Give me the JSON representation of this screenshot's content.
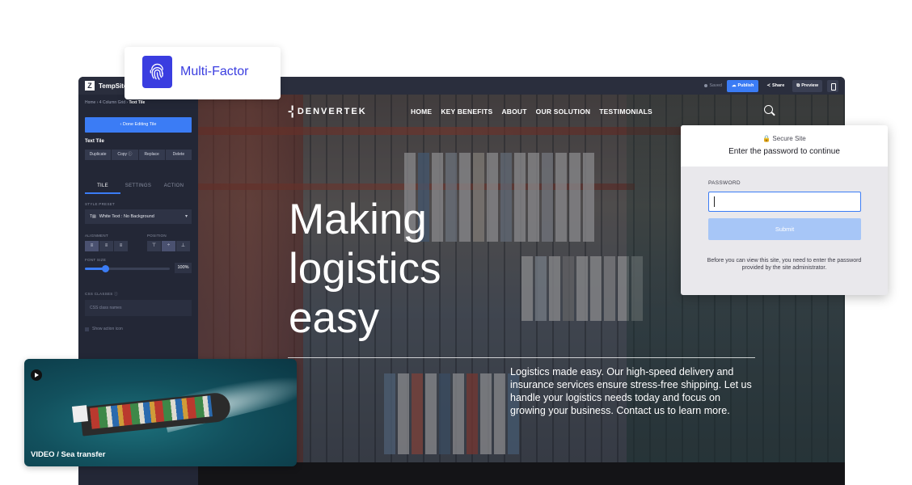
{
  "app": {
    "brand_name": "TempSite",
    "brand_logo_letter": "Z",
    "saved_label": "Saved",
    "publish_label": "Publish",
    "share_label": "Share",
    "preview_label": "Preview"
  },
  "sidebar": {
    "breadcrumb": [
      "Home",
      "4 Column Grid",
      "Text Tile"
    ],
    "done_label": "‹  Done Editing Tile",
    "tile_title": "Text Tile",
    "actions": [
      "Duplicate",
      "Copy ⓘ",
      "Replace",
      "Delete"
    ],
    "tabs": [
      "TILE",
      "SETTINGS",
      "ACTION"
    ],
    "active_tab": "TILE",
    "style_preset_label": "STYLE PRESET",
    "style_preset_value": "White Text : No Background",
    "alignment_label": "ALIGNMENT",
    "position_label": "POSITION",
    "font_size_label": "FONT SIZE",
    "font_size_value": "100%",
    "font_size_fraction": 0.24,
    "css_classes_label": "CSS CLASSES ⓘ",
    "css_placeholder": "CSS class names",
    "show_action_icon_label": "Show action icon"
  },
  "site": {
    "logo_mark": "-¦",
    "logo_name": "DENVERTEK",
    "nav": [
      "HOME",
      "KEY BENEFITS",
      "ABOUT",
      "OUR SOLUTION",
      "TESTIMONIALS"
    ],
    "hero_title_lines": [
      "Making",
      "logistics",
      "easy"
    ],
    "hero_description": "Logistics made easy. Our high-speed delivery and insurance services ensure stress-free shipping. Let us handle your logistics needs today and focus on growing your business. Contact us to learn more."
  },
  "mfa": {
    "label": "Multi-Factor"
  },
  "secure_modal": {
    "site_label": "🔒 Secure Site",
    "title": "Enter the password to continue",
    "password_label": "PASSWORD",
    "password_value": "",
    "submit_label": "Submit",
    "note": "Before you can view this site, you need to enter the password provided by the site administrator."
  },
  "video": {
    "label": "VIDEO / Sea transfer"
  },
  "colors": {
    "accent": "#3b7cf5",
    "mfa_blue": "#3a3de0",
    "sidebar_bg": "#232736",
    "submit_disabled": "#a7c6f7"
  }
}
